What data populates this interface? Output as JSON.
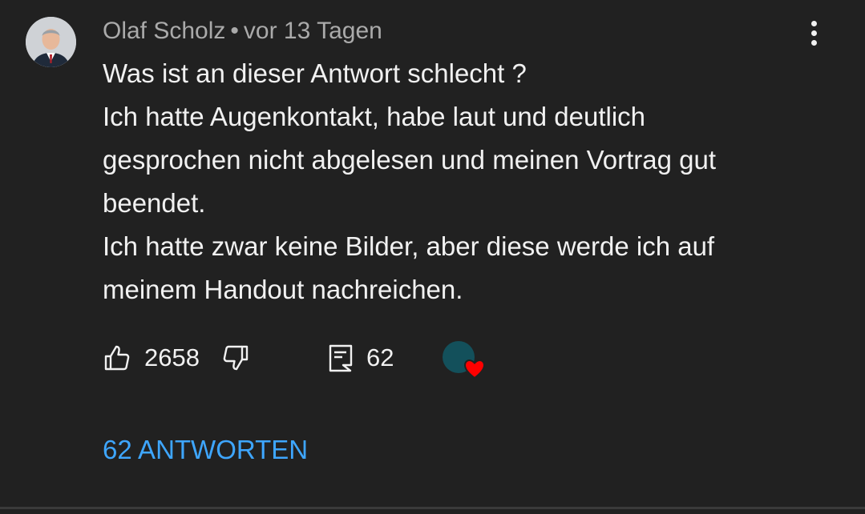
{
  "comment": {
    "author": "Olaf Scholz",
    "separator": "•",
    "timestamp": "vor 13 Tagen",
    "lines": [
      "Was ist an dieser Antwort schlecht ?",
      "Ich hatte Augenkontakt, habe laut und deutlich",
      "gesprochen nicht abgelesen und meinen Vortrag gut",
      "beendet.",
      "Ich hatte zwar keine Bilder, aber diese werde ich auf",
      "meinem Handout nachreichen."
    ],
    "like_count": "2658",
    "reply_count": "62",
    "replies_link": "62 ANTWORTEN"
  },
  "icons": {
    "menu": "more-vert-icon",
    "like": "thumbs-up-icon",
    "dislike": "thumbs-down-icon",
    "reply": "comment-icon",
    "creator_heart": "creator-heart-icon"
  },
  "colors": {
    "background": "#212121",
    "text": "#f1f1f1",
    "meta": "#aaaaaa",
    "link": "#3ea6ff",
    "heart": "#ff0000",
    "creator_avatar": "#13505b"
  }
}
